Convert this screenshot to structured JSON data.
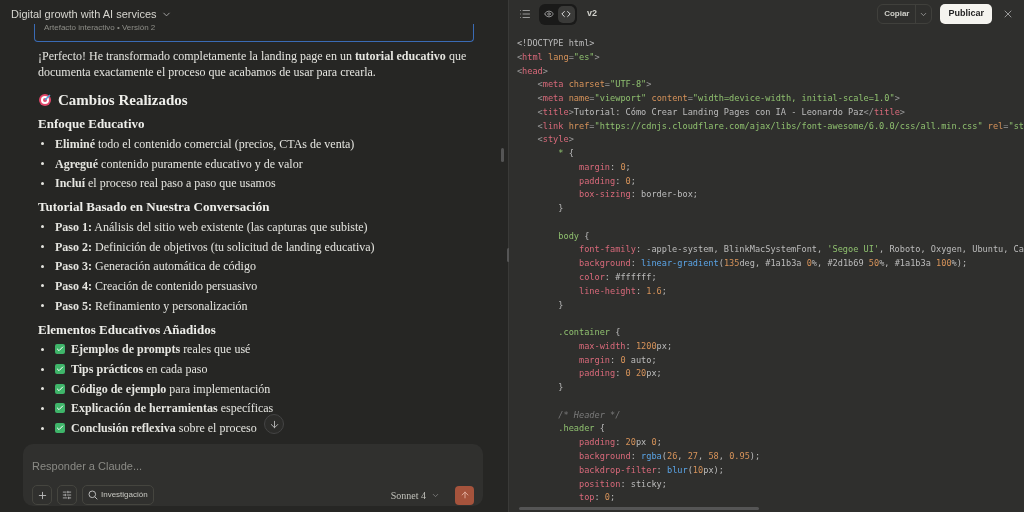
{
  "chat": {
    "title": "Digital growth with AI services",
    "artifact_card": {
      "caption": "Artefacto interactivo • Versión 2"
    },
    "intro": "¡Perfecto! He transformado completamente la landing page en un **tutorial educativo** que documenta exactamente el proceso que acabamos de usar para crearla.",
    "heading": "Cambios Realizados",
    "sections": [
      {
        "title": "Enfoque Educativo",
        "items": [
          {
            "kind": "bullet",
            "text": "**Eliminé** todo el contenido comercial (precios, CTAs de venta)"
          },
          {
            "kind": "bullet",
            "text": "**Agregué** contenido puramente educativo y de valor"
          },
          {
            "kind": "bullet",
            "text": "**Incluí** el proceso real paso a paso que usamos"
          }
        ]
      },
      {
        "title": "Tutorial Basado en Nuestra Conversación",
        "items": [
          {
            "kind": "bullet",
            "text": "**Paso 1:** Análisis del sitio web existente (las capturas que subiste)"
          },
          {
            "kind": "bullet",
            "text": "**Paso 2:** Definición de objetivos (tu solicitud de landing educativa)"
          },
          {
            "kind": "bullet",
            "text": "**Paso 3:** Generación automática de código"
          },
          {
            "kind": "bullet",
            "text": "**Paso 4:** Creación de contenido persuasivo"
          },
          {
            "kind": "bullet",
            "text": "**Paso 5:** Refinamiento y personalización"
          }
        ]
      },
      {
        "title": "Elementos Educativos Añadidos",
        "items": [
          {
            "kind": "check",
            "text": "**Ejemplos de prompts** reales que usé"
          },
          {
            "kind": "check",
            "text": "**Tips prácticos** en cada paso"
          },
          {
            "kind": "check",
            "text": "**Código de ejemplo** para implementación"
          },
          {
            "kind": "check",
            "text": "**Explicación de herramientas** específicas"
          },
          {
            "kind": "check",
            "text": "**Conclusión reflexiva** sobre el proceso"
          }
        ]
      }
    ],
    "composer": {
      "placeholder": "Responder a Claude...",
      "research_button": "Investigación",
      "model": "Sonnet 4"
    }
  },
  "artifact": {
    "view_toggle": [
      {
        "kind": "preview",
        "selected": false
      },
      {
        "kind": "code",
        "selected": true
      }
    ],
    "version": "v2",
    "copy_button": "Copiar",
    "publish_button": "Publicar",
    "code_lines": [
      [
        {
          "kind": "plain",
          "text": "<!DOCTYPE html>"
        }
      ],
      [
        {
          "kind": "punct",
          "text": "<"
        },
        {
          "kind": "tag",
          "text": "html "
        },
        {
          "kind": "attr",
          "text": "lang"
        },
        {
          "kind": "punct",
          "text": "="
        },
        {
          "kind": "string",
          "text": "\"es\""
        },
        {
          "kind": "punct",
          "text": ">"
        }
      ],
      [
        {
          "kind": "punct",
          "text": "<"
        },
        {
          "kind": "tag",
          "text": "head"
        },
        {
          "kind": "punct",
          "text": ">"
        }
      ],
      [
        {
          "kind": "punct",
          "text": "    <"
        },
        {
          "kind": "tag",
          "text": "meta "
        },
        {
          "kind": "attr",
          "text": "charset"
        },
        {
          "kind": "punct",
          "text": "="
        },
        {
          "kind": "string",
          "text": "\"UTF-8\""
        },
        {
          "kind": "punct",
          "text": ">"
        }
      ],
      [
        {
          "kind": "punct",
          "text": "    <"
        },
        {
          "kind": "tag",
          "text": "meta "
        },
        {
          "kind": "attr",
          "text": "name"
        },
        {
          "kind": "punct",
          "text": "="
        },
        {
          "kind": "string",
          "text": "\"viewport\" "
        },
        {
          "kind": "attr",
          "text": "content"
        },
        {
          "kind": "punct",
          "text": "="
        },
        {
          "kind": "string",
          "text": "\"width=device-width, initial-scale=1.0\""
        },
        {
          "kind": "punct",
          "text": ">"
        }
      ],
      [
        {
          "kind": "punct",
          "text": "    <"
        },
        {
          "kind": "tag",
          "text": "title"
        },
        {
          "kind": "punct",
          "text": ">"
        },
        {
          "kind": "plain",
          "text": "Tutorial: Cómo Crear Landing Pages con IA - Leonardo Paz"
        },
        {
          "kind": "punct",
          "text": "</"
        },
        {
          "kind": "tag",
          "text": "title"
        },
        {
          "kind": "punct",
          "text": ">"
        }
      ],
      [
        {
          "kind": "punct",
          "text": "    <"
        },
        {
          "kind": "tag",
          "text": "link "
        },
        {
          "kind": "attr",
          "text": "href"
        },
        {
          "kind": "punct",
          "text": "="
        },
        {
          "kind": "string",
          "text": "\"https://cdnjs.cloudflare.com/ajax/libs/font-awesome/6.0.0/css/all.min.css\" "
        },
        {
          "kind": "attr",
          "text": "rel"
        },
        {
          "kind": "punct",
          "text": "="
        },
        {
          "kind": "string",
          "text": "\"st"
        }
      ],
      [
        {
          "kind": "punct",
          "text": "    <"
        },
        {
          "kind": "tag",
          "text": "style"
        },
        {
          "kind": "punct",
          "text": ">"
        }
      ],
      [
        {
          "kind": "selector",
          "text": "        * "
        },
        {
          "kind": "plain",
          "text": "{"
        }
      ],
      [
        {
          "kind": "prop",
          "text": "            margin"
        },
        {
          "kind": "plain",
          "text": ": "
        },
        {
          "kind": "number",
          "text": "0"
        },
        {
          "kind": "plain",
          "text": ";"
        }
      ],
      [
        {
          "kind": "prop",
          "text": "            padding"
        },
        {
          "kind": "plain",
          "text": ": "
        },
        {
          "kind": "number",
          "text": "0"
        },
        {
          "kind": "plain",
          "text": ";"
        }
      ],
      [
        {
          "kind": "prop",
          "text": "            box-sizing"
        },
        {
          "kind": "plain",
          "text": ": border-box;"
        }
      ],
      [
        {
          "kind": "plain",
          "text": "        }"
        }
      ],
      {
        "kind": "blank"
      },
      [
        {
          "kind": "selector",
          "text": "        body "
        },
        {
          "kind": "plain",
          "text": "{"
        }
      ],
      [
        {
          "kind": "prop",
          "text": "            font-family"
        },
        {
          "kind": "plain",
          "text": ": -apple-system, BlinkMacSystemFont, "
        },
        {
          "kind": "string",
          "text": "'Segoe UI'"
        },
        {
          "kind": "plain",
          "text": ", Roboto, Oxygen, Ubuntu, Ca"
        }
      ],
      [
        {
          "kind": "prop",
          "text": "            background"
        },
        {
          "kind": "plain",
          "text": ": "
        },
        {
          "kind": "func",
          "text": "linear-gradient"
        },
        {
          "kind": "plain",
          "text": "("
        },
        {
          "kind": "number",
          "text": "135"
        },
        {
          "kind": "plain",
          "text": "deg, #1a1b3a "
        },
        {
          "kind": "number",
          "text": "0"
        },
        {
          "kind": "plain",
          "text": "%, #2d1b69 "
        },
        {
          "kind": "number",
          "text": "50"
        },
        {
          "kind": "plain",
          "text": "%, #1a1b3a "
        },
        {
          "kind": "number",
          "text": "100"
        },
        {
          "kind": "plain",
          "text": "%);"
        }
      ],
      [
        {
          "kind": "prop",
          "text": "            color"
        },
        {
          "kind": "plain",
          "text": ": #ffffff;"
        }
      ],
      [
        {
          "kind": "prop",
          "text": "            line-height"
        },
        {
          "kind": "plain",
          "text": ": "
        },
        {
          "kind": "number",
          "text": "1.6"
        },
        {
          "kind": "plain",
          "text": ";"
        }
      ],
      [
        {
          "kind": "plain",
          "text": "        }"
        }
      ],
      {
        "kind": "blank"
      },
      [
        {
          "kind": "selector",
          "text": "        .container "
        },
        {
          "kind": "plain",
          "text": "{"
        }
      ],
      [
        {
          "kind": "prop",
          "text": "            max-width"
        },
        {
          "kind": "plain",
          "text": ": "
        },
        {
          "kind": "number",
          "text": "1200"
        },
        {
          "kind": "plain",
          "text": "px;"
        }
      ],
      [
        {
          "kind": "prop",
          "text": "            margin"
        },
        {
          "kind": "plain",
          "text": ": "
        },
        {
          "kind": "number",
          "text": "0"
        },
        {
          "kind": "plain",
          "text": " auto;"
        }
      ],
      [
        {
          "kind": "prop",
          "text": "            padding"
        },
        {
          "kind": "plain",
          "text": ": "
        },
        {
          "kind": "number",
          "text": "0 20"
        },
        {
          "kind": "plain",
          "text": "px;"
        }
      ],
      [
        {
          "kind": "plain",
          "text": "        }"
        }
      ],
      {
        "kind": "blank"
      },
      [
        {
          "kind": "comment",
          "text": "        /* Header */"
        }
      ],
      [
        {
          "kind": "selector",
          "text": "        .header "
        },
        {
          "kind": "plain",
          "text": "{"
        }
      ],
      [
        {
          "kind": "prop",
          "text": "            padding"
        },
        {
          "kind": "plain",
          "text": ": "
        },
        {
          "kind": "number",
          "text": "20"
        },
        {
          "kind": "plain",
          "text": "px "
        },
        {
          "kind": "number",
          "text": "0"
        },
        {
          "kind": "plain",
          "text": ";"
        }
      ],
      [
        {
          "kind": "prop",
          "text": "            background"
        },
        {
          "kind": "plain",
          "text": ": "
        },
        {
          "kind": "func",
          "text": "rgba"
        },
        {
          "kind": "plain",
          "text": "("
        },
        {
          "kind": "number",
          "text": "26"
        },
        {
          "kind": "plain",
          "text": ", "
        },
        {
          "kind": "number",
          "text": "27"
        },
        {
          "kind": "plain",
          "text": ", "
        },
        {
          "kind": "number",
          "text": "58"
        },
        {
          "kind": "plain",
          "text": ", "
        },
        {
          "kind": "number",
          "text": "0.95"
        },
        {
          "kind": "plain",
          "text": ");"
        }
      ],
      [
        {
          "kind": "prop",
          "text": "            backdrop-filter"
        },
        {
          "kind": "plain",
          "text": ": "
        },
        {
          "kind": "func",
          "text": "blur"
        },
        {
          "kind": "plain",
          "text": "("
        },
        {
          "kind": "number",
          "text": "10"
        },
        {
          "kind": "plain",
          "text": "px);"
        }
      ],
      [
        {
          "kind": "prop",
          "text": "            position"
        },
        {
          "kind": "plain",
          "text": ": sticky;"
        }
      ],
      [
        {
          "kind": "prop",
          "text": "            top"
        },
        {
          "kind": "plain",
          "text": ": "
        },
        {
          "kind": "number",
          "text": "0"
        },
        {
          "kind": "plain",
          "text": ";"
        }
      ]
    ]
  }
}
